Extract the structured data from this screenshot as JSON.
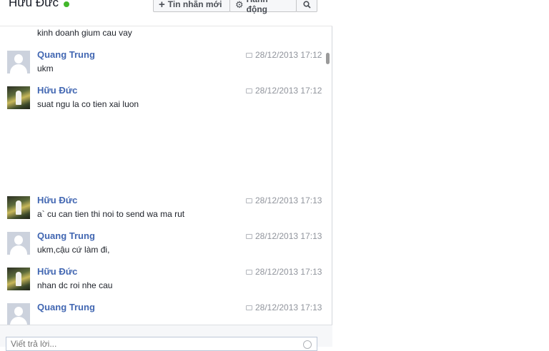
{
  "header": {
    "contact_name": "Hữu Đức",
    "new_message_label": "Tin nhắn mới",
    "actions_label": "Hành động"
  },
  "messages": [
    {
      "sender": "",
      "text": "kinh doanh gium cau vay",
      "time": ""
    },
    {
      "sender": "Quang Trung",
      "text": "ukm",
      "time": "28/12/2013 17:12"
    },
    {
      "sender": "Hữu Đức",
      "text": "suat ngu la co tien xai luon",
      "time": "28/12/2013 17:12"
    },
    {
      "sender": "Hữu Đức",
      "text": "a` cu can tien thi noi to send wa ma rut",
      "time": "28/12/2013 17:13"
    },
    {
      "sender": "Quang Trung",
      "text": "ukm,cậu cứ làm đi,",
      "time": "28/12/2013 17:13"
    },
    {
      "sender": "Hữu Đức",
      "text": "nhan dc roi nhe cau",
      "time": "28/12/2013 17:13"
    },
    {
      "sender": "Quang Trung",
      "text": "",
      "time": "28/12/2013 17:13"
    }
  ],
  "reply": {
    "placeholder": "Viết trả lời..."
  },
  "icons": {
    "plus": "plus-icon",
    "gear": "gear-icon",
    "search": "search-icon",
    "message_time": "chat-bubble-icon",
    "emoji": "emoji-icon"
  },
  "colors": {
    "sender_link": "#4267b2",
    "online": "#42b72a"
  }
}
